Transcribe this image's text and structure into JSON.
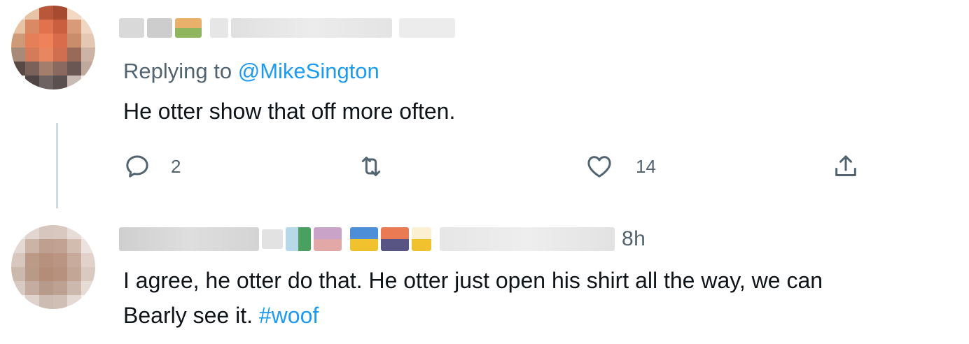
{
  "tweet1": {
    "replying_prefix": "Replying to ",
    "replying_handle": "@MikeSington",
    "text": "He otter show that off more often.",
    "actions": {
      "reply_icon": "reply-icon",
      "reply_count": "2",
      "retweet_icon": "retweet-icon",
      "retweet_count": "",
      "like_icon": "heart-icon",
      "like_count": "14",
      "share_icon": "share-icon"
    }
  },
  "tweet2": {
    "time": "8h",
    "text_line1": "I agree, he otter do that. He otter just open his shirt all the way, we can",
    "text_line2_prefix": "Bearly see it. ",
    "hashtag": "#woof"
  },
  "colors": {
    "accent": "#1d9bf0",
    "secondary_text": "#536471",
    "primary_text": "#0f1419",
    "thread_line": "#cfd9de"
  }
}
